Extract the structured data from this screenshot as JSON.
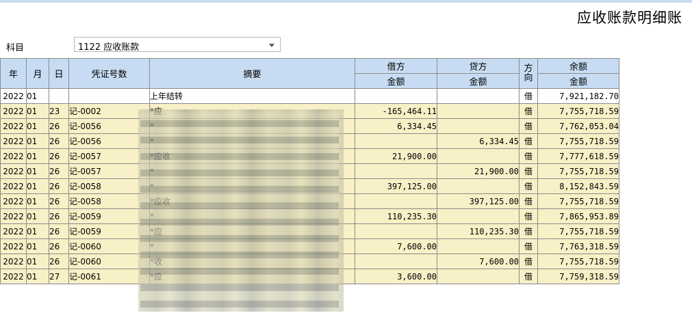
{
  "page": {
    "title": "应收账款明细账"
  },
  "subject": {
    "label": "科目",
    "value": "1122 应收账款"
  },
  "table": {
    "headers": {
      "year": "年",
      "month": "月",
      "day": "日",
      "voucher": "凭证号数",
      "summary": "摘要",
      "debit": "借方",
      "credit": "贷方",
      "direction": "方向",
      "balance": "余额",
      "debit_amount": "金额",
      "credit_amount": "金额",
      "balance_amount": "金额"
    },
    "rows": [
      {
        "year": "2022",
        "month": "01",
        "day": "",
        "voucher": "",
        "summary": "上年结转",
        "debit": "",
        "credit": "",
        "direction": "借",
        "balance": "7,921,182.70"
      },
      {
        "year": "2022",
        "month": "01",
        "day": "23",
        "voucher": "记-0002",
        "summary": "*应",
        "debit": "-165,464.11",
        "credit": "",
        "direction": "借",
        "balance": "7,755,718.59"
      },
      {
        "year": "2022",
        "month": "01",
        "day": "26",
        "voucher": "记-0056",
        "summary": "*",
        "debit": "6,334.45",
        "credit": "",
        "direction": "借",
        "balance": "7,762,053.04"
      },
      {
        "year": "2022",
        "month": "01",
        "day": "26",
        "voucher": "记-0056",
        "summary": "*",
        "debit": "",
        "credit": "6,334.45",
        "direction": "借",
        "balance": "7,755,718.59"
      },
      {
        "year": "2022",
        "month": "01",
        "day": "26",
        "voucher": "记-0057",
        "summary": "*应收",
        "debit": "21,900.00",
        "credit": "",
        "direction": "借",
        "balance": "7,777,618.59"
      },
      {
        "year": "2022",
        "month": "01",
        "day": "26",
        "voucher": "记-0057",
        "summary": "*",
        "debit": "",
        "credit": "21,900.00",
        "direction": "借",
        "balance": "7,755,718.59"
      },
      {
        "year": "2022",
        "month": "01",
        "day": "26",
        "voucher": "记-0058",
        "summary": "*",
        "debit": "397,125.00",
        "credit": "",
        "direction": "借",
        "balance": "8,152,843.59"
      },
      {
        "year": "2022",
        "month": "01",
        "day": "26",
        "voucher": "记-0058",
        "summary": "*应收",
        "debit": "",
        "credit": "397,125.00",
        "direction": "借",
        "balance": "7,755,718.59"
      },
      {
        "year": "2022",
        "month": "01",
        "day": "26",
        "voucher": "记-0059",
        "summary": "*",
        "debit": "110,235.30",
        "credit": "",
        "direction": "借",
        "balance": "7,865,953.89"
      },
      {
        "year": "2022",
        "month": "01",
        "day": "26",
        "voucher": "记-0059",
        "summary": "*应",
        "debit": "",
        "credit": "110,235.30",
        "direction": "借",
        "balance": "7,755,718.59"
      },
      {
        "year": "2022",
        "month": "01",
        "day": "26",
        "voucher": "记-0060",
        "summary": "*",
        "debit": "7,600.00",
        "credit": "",
        "direction": "借",
        "balance": "7,763,318.59"
      },
      {
        "year": "2022",
        "month": "01",
        "day": "26",
        "voucher": "记-0060",
        "summary": "*收",
        "debit": "",
        "credit": "7,600.00",
        "direction": "借",
        "balance": "7,755,718.59"
      },
      {
        "year": "2022",
        "month": "01",
        "day": "27",
        "voucher": "记-0061",
        "summary": "*应",
        "debit": "3,600.00",
        "credit": "",
        "direction": "借",
        "balance": "7,759,318.59"
      }
    ]
  },
  "colors": {
    "header_bg": "#c7dcf2",
    "row_bg": "#f8f0c6",
    "first_row_bg": "#ffffff",
    "top_strip": "#c9dbef"
  }
}
